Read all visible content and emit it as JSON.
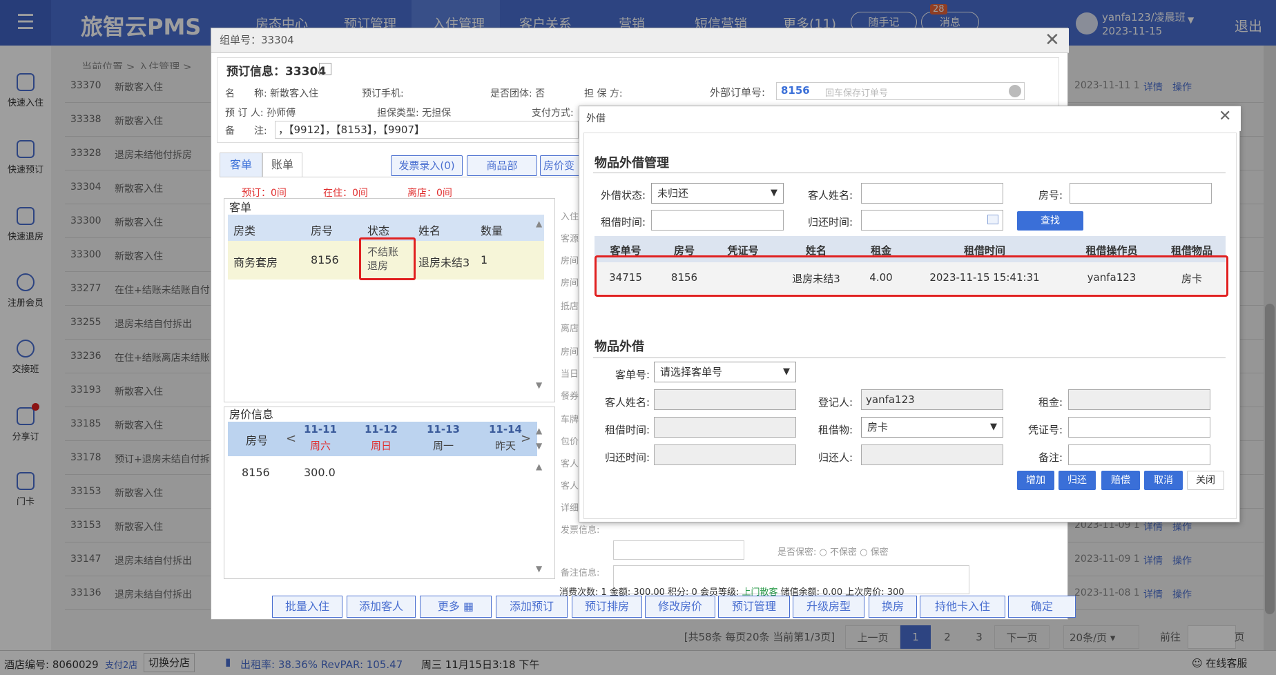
{
  "app": {
    "logo": "旅智云PMS",
    "nav": [
      "房态中心",
      "预订管理",
      "入住管理",
      "客户关系",
      "营销",
      "短信营销",
      "更多(11)"
    ],
    "pill1": "随手记",
    "pill2": "消息",
    "badge": "28",
    "user": "yanfa123/凌晨班",
    "user_date": "2023-11-15",
    "logout": "退出"
  },
  "sidebar": [
    "快速入住",
    "快速预订",
    "快速退房",
    "注册会员",
    "交接班",
    "分享订",
    "门卡"
  ],
  "breadcrumb": "当前位置 > 入住管理 >",
  "rows": [
    {
      "id": "33370",
      "type": "新散客入住",
      "date": "2023-11-11 1"
    },
    {
      "id": "33338",
      "type": "新散客入住",
      "date": ""
    },
    {
      "id": "33328",
      "type": "退房未结他付拆房",
      "date": ""
    },
    {
      "id": "33304",
      "type": "新散客入住",
      "date": ""
    },
    {
      "id": "33300",
      "type": "新散客入住",
      "date": ""
    },
    {
      "id": "33300",
      "type": "新散客入住",
      "date": ""
    },
    {
      "id": "33277",
      "type": "在住+结账未结账自付",
      "date": ""
    },
    {
      "id": "33255",
      "type": "退房未结自付拆出",
      "date": ""
    },
    {
      "id": "33236",
      "type": "在住+结账离店未结账",
      "date": ""
    },
    {
      "id": "33193",
      "type": "新散客入住",
      "date": ""
    },
    {
      "id": "33185",
      "type": "新散客入住",
      "date": ""
    },
    {
      "id": "33178",
      "type": "预订+退房未结自付拆",
      "date": ""
    },
    {
      "id": "33153",
      "type": "新散客入住",
      "date": ""
    },
    {
      "id": "33153",
      "type": "新散客入住",
      "date": "2023-11-09 1"
    },
    {
      "id": "33147",
      "type": "退房未结自付拆出",
      "date": "2023-11-09 1"
    },
    {
      "id": "33136",
      "type": "退房未结自付拆出",
      "date": "2023-11-08 1"
    }
  ],
  "row_links": {
    "detail": "详情",
    "op": "操作"
  },
  "pager": {
    "summary": "[共58条 每页20条 当前第1/3页]",
    "prev": "上一页",
    "pages": [
      "1",
      "2",
      "3"
    ],
    "next": "下一页",
    "per": "20条/页",
    "goto": "前往",
    "unit": "页"
  },
  "status": {
    "store_label": "酒店编号:",
    "store_no": "8060029",
    "branches": "支付2店",
    "switch": "切换分店",
    "rate": "出租率: 38.36% RevPAR: 105.47",
    "datetime": "周三 11月15日3:18 下午",
    "service": "在线客服"
  },
  "m1": {
    "title": "组单号：33304",
    "booking_title": "预订信息：33304",
    "f_name": "名　　称: 新散客入住",
    "f_phone": "预订手机:",
    "f_group": "是否团体: 否",
    "f_guarantor": "担 保 方:",
    "f_ext_label": "外部订单号:",
    "f_ext_value": "8156",
    "f_ext_placeholder": "回车保存订单号",
    "f_booker": "预 订 人: 孙师傅",
    "f_gtype": "担保类型: 无担保",
    "f_pay": "支付方式:",
    "f_note_label": "备　　注:",
    "f_note": "，【9912】，【8153】，【9907】",
    "tab_guest": "客单",
    "tab_bill": "账单",
    "btn_invoice": "发票录入(0)",
    "btn_goods": "商品部",
    "btn_price": "房价变更",
    "cnt_booked": "预订：0间",
    "cnt_in": "在住：0间",
    "cnt_out": "离店：0间",
    "guest_title": "客单",
    "guest_headers": [
      "房类",
      "房号",
      "状态",
      "姓名",
      "数量"
    ],
    "guest_row": [
      "商务套房",
      "8156",
      "不结账\n退房",
      "退房未结3",
      "1"
    ],
    "price_title": "房价信息",
    "price_headers": {
      "room": "房号",
      "d1": "11-11",
      "w1": "周六",
      "d2": "11-12",
      "w2": "周日",
      "d3": "11-13",
      "w3": "周一",
      "d4": "11-14",
      "w4": "昨天"
    },
    "price_row": [
      "8156",
      "300.0"
    ],
    "right_labels": [
      "入住",
      "客源",
      "房间",
      "房间",
      "抵店",
      "离店",
      "房间",
      "当日",
      "餐券",
      "车牌",
      "包价",
      "客人",
      "客人",
      "详细",
      "发票信息:",
      "备注信息:"
    ],
    "keep_label": "是否保密: ○ 不保密 ○ 保密",
    "summary": {
      "a": "消费次数: 1 金额: 300.00 积分: 0 会员等级: ",
      "b": "上门散客",
      "c": " 储值余额: 0.00 上次房价: 300"
    },
    "buttons": [
      "批量入住",
      "添加客人",
      "更多",
      "添加预订",
      "预订排房",
      "修改房价",
      "预订管理",
      "升级房型",
      "换房",
      "持他卡入住",
      "确定"
    ]
  },
  "m2": {
    "title": "外借",
    "sec1": "物品外借管理",
    "status_label": "外借状态:",
    "status_value": "未归还",
    "guest_label": "客人姓名:",
    "room_label": "房号:",
    "rent_time_label": "租借时间:",
    "return_time_label": "归还时间:",
    "search_btn": "查找",
    "headers": [
      "客单号",
      "房号",
      "凭证号",
      "姓名",
      "租金",
      "租借时间",
      "租借操作员",
      "租借物品"
    ],
    "row": [
      "34715",
      "8156",
      "",
      "退房未结3",
      "4.00",
      "2023-11-15 15:41:31",
      "yanfa123",
      "房卡"
    ],
    "sec2": "物品外借",
    "order_label": "客单号:",
    "order_value": "请选择客单号",
    "gname_label": "客人姓名:",
    "reg_label": "登记人:",
    "reg_value": "yanfa123",
    "rent_label": "租金:",
    "rtime_label": "租借时间:",
    "item_label": "租借物:",
    "item_value": "房卡",
    "voucher_label": "凭证号:",
    "ret_label": "归还时间:",
    "retby_label": "归还人:",
    "remark_label": "备注:",
    "btns": [
      "增加",
      "归还",
      "赔偿",
      "取消",
      "关闭"
    ]
  }
}
